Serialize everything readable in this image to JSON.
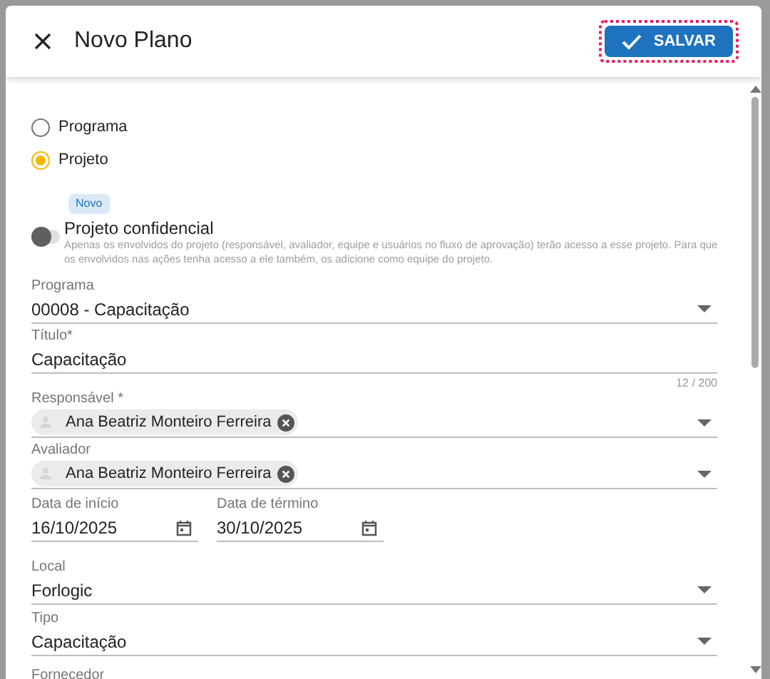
{
  "dialog": {
    "title": "Novo Plano",
    "save_button": "SALVAR"
  },
  "type_options": [
    {
      "label": "Programa",
      "selected": false
    },
    {
      "label": "Projeto",
      "selected": true
    }
  ],
  "confidential": {
    "badge": "Novo",
    "label": "Projeto confidencial",
    "on": false,
    "help": "Apenas os envolvidos do projeto (responsável, avaliador, equipe e usuários no fluxo de aprovação) terão acesso a esse projeto. Para que os envolvidos nas ações tenha acesso a ele também, os adicione como equipe do projeto."
  },
  "fields": [
    {
      "kind": "select",
      "label": "Programa",
      "value": "00008 - Capacitação"
    },
    {
      "kind": "text",
      "label": "Título*",
      "value": "Capacitação",
      "counter": "12 / 200"
    },
    {
      "kind": "chip",
      "label": "Responsável *",
      "value": "Ana Beatriz Monteiro Ferreira"
    },
    {
      "kind": "chip",
      "label": "Avaliador",
      "value": "Ana Beatriz Monteiro Ferreira"
    },
    {
      "kind": "dates",
      "dates": [
        {
          "label": "Data de início",
          "value": "16/10/2025"
        },
        {
          "label": "Data de término",
          "value": "30/10/2025"
        }
      ]
    },
    {
      "kind": "select",
      "label": "Local",
      "value": "Forlogic"
    },
    {
      "kind": "select",
      "label": "Tipo",
      "value": "Capacitação"
    },
    {
      "kind": "label",
      "label": "Fornecedor"
    }
  ]
}
